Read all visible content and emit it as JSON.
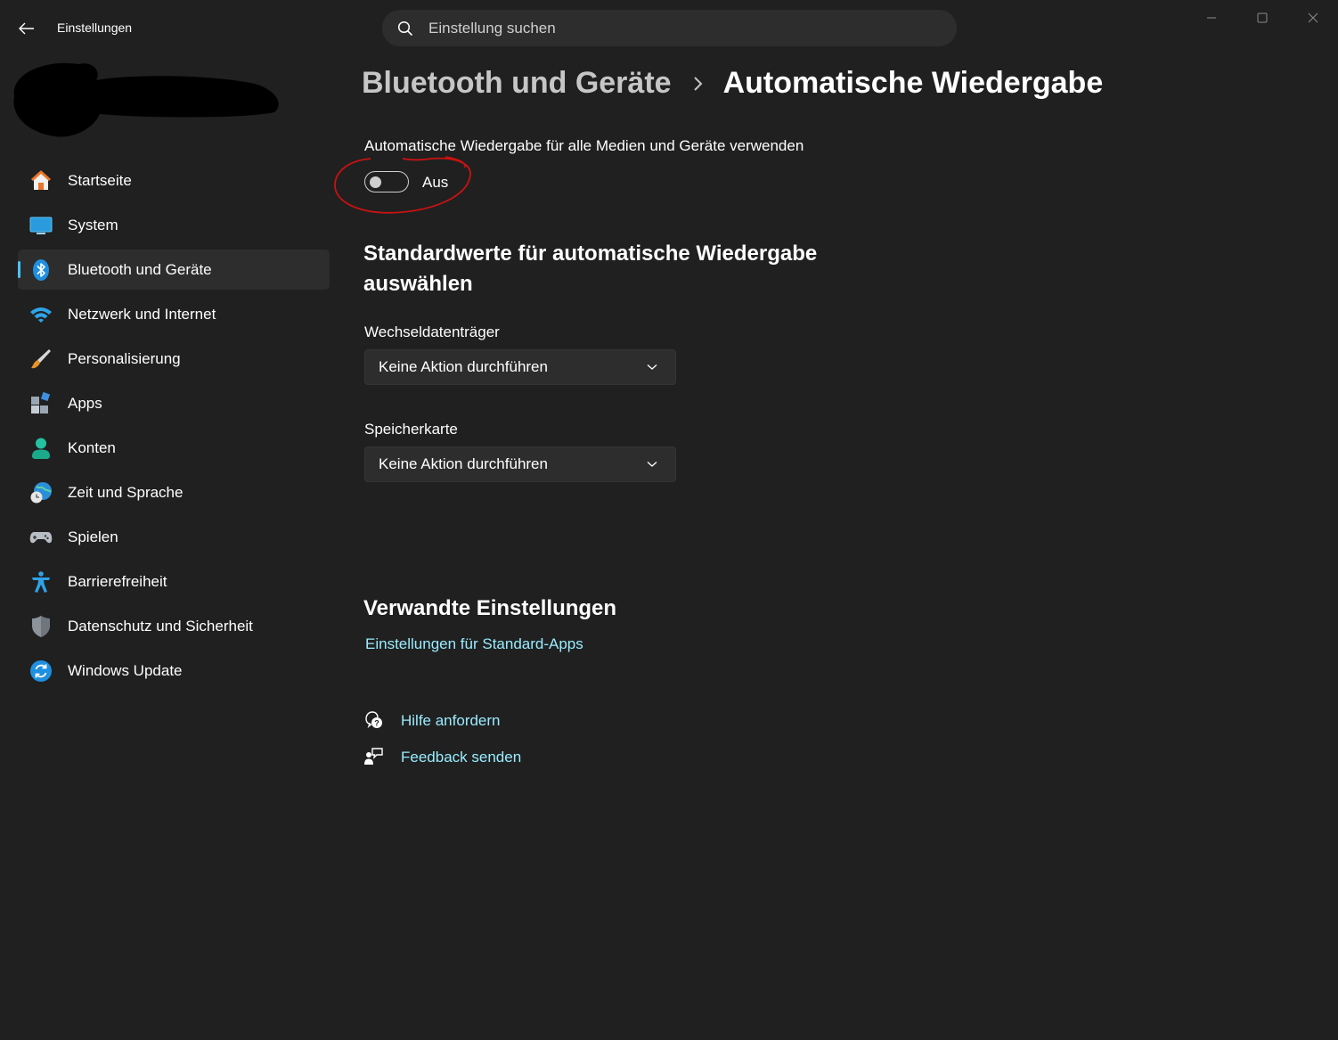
{
  "titlebar": {
    "app_title": "Einstellungen",
    "back_icon": "back-arrow-icon",
    "search_placeholder": "Einstellung suchen",
    "window_controls": [
      "minimize",
      "maximize",
      "close"
    ]
  },
  "sidebar": {
    "items": [
      {
        "label": "Startseite",
        "icon": "home-icon",
        "active": false
      },
      {
        "label": "System",
        "icon": "system-icon",
        "active": false
      },
      {
        "label": "Bluetooth und Geräte",
        "icon": "bluetooth-icon",
        "active": true
      },
      {
        "label": "Netzwerk und Internet",
        "icon": "wifi-icon",
        "active": false
      },
      {
        "label": "Personalisierung",
        "icon": "brush-icon",
        "active": false
      },
      {
        "label": "Apps",
        "icon": "apps-icon",
        "active": false
      },
      {
        "label": "Konten",
        "icon": "account-icon",
        "active": false
      },
      {
        "label": "Zeit und Sprache",
        "icon": "time-language-icon",
        "active": false
      },
      {
        "label": "Spielen",
        "icon": "gamepad-icon",
        "active": false
      },
      {
        "label": "Barrierefreiheit",
        "icon": "accessibility-icon",
        "active": false
      },
      {
        "label": "Datenschutz und Sicherheit",
        "icon": "shield-icon",
        "active": false
      },
      {
        "label": "Windows Update",
        "icon": "update-icon",
        "active": false
      }
    ]
  },
  "main": {
    "breadcrumb": {
      "parent": "Bluetooth und Geräte",
      "current": "Automatische Wiedergabe"
    },
    "autoplay": {
      "label": "Automatische Wiedergabe für alle Medien und Geräte verwenden",
      "toggle_state": "Aus",
      "toggle_on": false
    },
    "defaults": {
      "heading": "Standardwerte für automatische Wiedergabe auswählen",
      "removable_label": "Wechseldatenträger",
      "removable_value": "Keine Aktion durchführen",
      "memory_card_label": "Speicherkarte",
      "memory_card_value": "Keine Aktion durchführen"
    },
    "related": {
      "heading": "Verwandte Einstellungen",
      "default_apps_link": "Einstellungen für Standard-Apps"
    },
    "help": {
      "get_help": "Hilfe anfordern",
      "feedback": "Feedback senden"
    }
  },
  "colors": {
    "background": "#202020",
    "surface": "#2d2d2d",
    "accent": "#4cc2ff",
    "link": "#99ebff",
    "annotation": "#d01010"
  }
}
